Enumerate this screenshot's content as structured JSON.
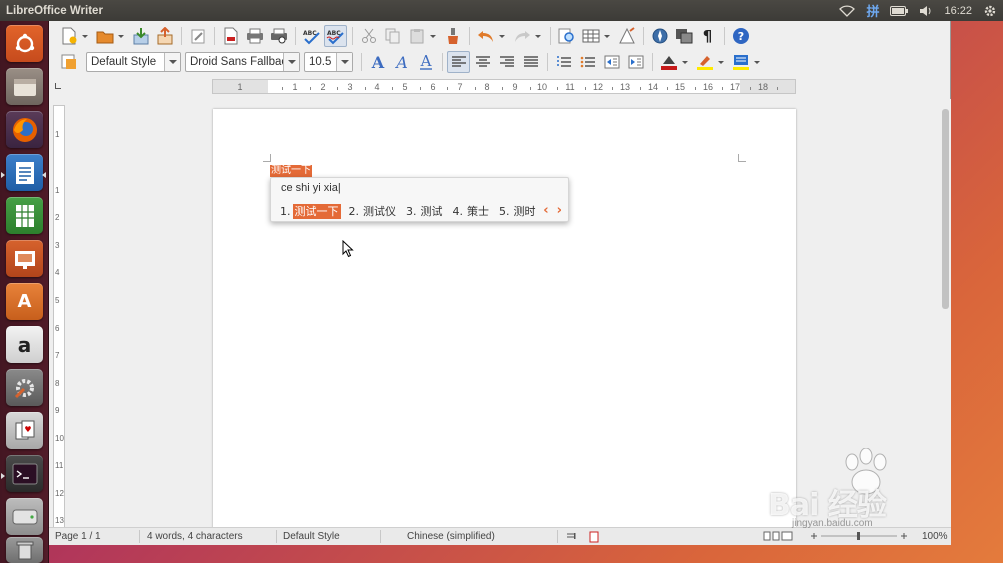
{
  "top_panel": {
    "title": "LibreOffice Writer",
    "ime_indicator": "拼",
    "clock": "16:22",
    "indicators": [
      "wifi-icon",
      "ime-icon",
      "battery-icon",
      "volume-icon",
      "clock",
      "gear-icon"
    ]
  },
  "launcher": {
    "items": [
      "ubuntu-logo-icon",
      "files-icon",
      "firefox-icon",
      "writer-icon",
      "calc-icon",
      "impress-icon",
      "software-center-icon",
      "amazon-icon",
      "system-settings-icon",
      "solitaire-icon",
      "terminal-icon",
      "disk-icon",
      "trash-icon"
    ]
  },
  "toolbar": {
    "paragraph_style": "Default Style",
    "font_name": "Droid Sans Fallbac",
    "font_size": "10.5"
  },
  "ruler": {
    "h_ticks": [
      "1",
      "1",
      "2",
      "3",
      "4",
      "5",
      "6",
      "7",
      "8",
      "9",
      "10",
      "11",
      "12",
      "13",
      "14",
      "15",
      "16",
      "17",
      "18"
    ],
    "v_ticks": [
      "1",
      "1",
      "2",
      "3",
      "4",
      "5",
      "6",
      "7",
      "8",
      "9",
      "10",
      "11",
      "12",
      "13"
    ]
  },
  "document": {
    "text": "测试一下"
  },
  "ime": {
    "preedit": "ce shi yi xia",
    "candidates": [
      {
        "index": "1.",
        "word": "测试一下",
        "selected": true
      },
      {
        "index": "2.",
        "word": "测试仪",
        "selected": false
      },
      {
        "index": "3.",
        "word": "测试",
        "selected": false
      },
      {
        "index": "4.",
        "word": "策士",
        "selected": false
      },
      {
        "index": "5.",
        "word": "测时",
        "selected": false
      }
    ],
    "prev": "‹",
    "next": "›"
  },
  "statusbar": {
    "page": "Page 1 / 1",
    "count": "4 words, 4 characters",
    "style": "Default Style",
    "language": "Chinese (simplified)",
    "zoom": "100%"
  },
  "watermark": {
    "text": "Bai 经验",
    "url": "jingyan.baidu.com"
  },
  "colors": {
    "accent": "#e46a37",
    "panel": "#3c3b37",
    "launcher": "#461923"
  }
}
